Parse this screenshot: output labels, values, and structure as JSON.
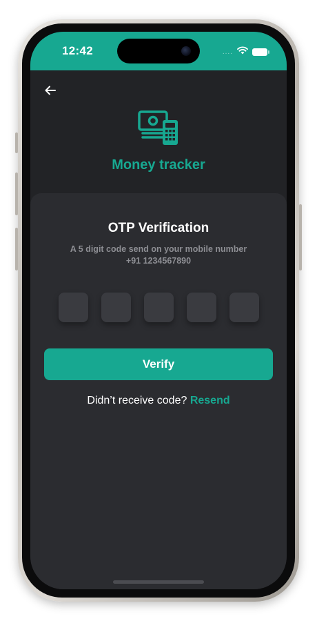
{
  "status_bar": {
    "time": "12:42",
    "signal_dots": "....",
    "color": "#17a891"
  },
  "header": {
    "back_icon": "arrow-left-icon",
    "logo_icon": "money-tracker-logo-icon",
    "app_title": "Money tracker"
  },
  "otp": {
    "title": "OTP Verification",
    "subtitle": "A 5 digit code send on your mobile number +91 1234567890",
    "digits": [
      "",
      "",
      "",
      "",
      ""
    ]
  },
  "actions": {
    "verify_label": "Verify",
    "resend_prompt": "Didn’t receive code?",
    "resend_label": "Resend"
  },
  "theme": {
    "accent": "#17a891",
    "background": "#222326",
    "card": "#2b2c30"
  }
}
